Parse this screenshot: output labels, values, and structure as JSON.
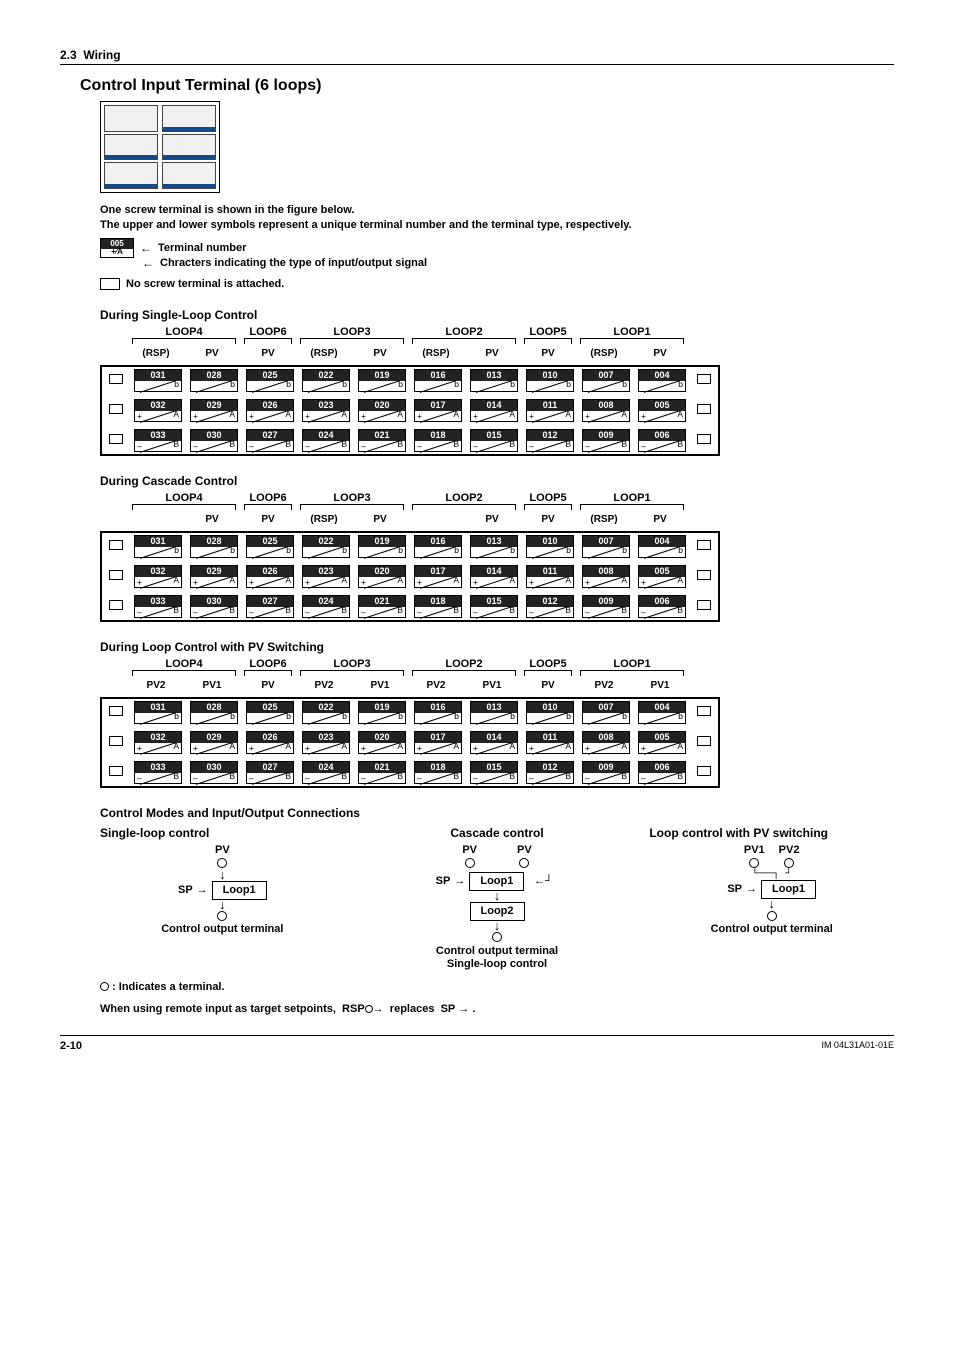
{
  "section_num": "2.3",
  "section_title": "Wiring",
  "title": "Control Input Terminal (6 loops)",
  "desc1": "One screw terminal is shown in the figure below.",
  "desc2": "The upper and lower symbols represent a unique terminal number and the terminal type, respectively.",
  "legend_terminal_num": "005",
  "legend_terminal_sym_left": "+",
  "legend_terminal_sym_right": "A",
  "legend_terminal_num_label": "Terminal number",
  "legend_terminal_sym_label": "Chracters indicating the type of input/output signal",
  "legend_no_screw": "No screw terminal is attached.",
  "single_loop_heading": "During Single-Loop Control",
  "cascade_heading": "During Cascade Control",
  "pvswitch_heading": "During Loop Control with PV Switching",
  "modes_heading": "Control Modes and Input/Output Connections",
  "mode_single": "Single-loop control",
  "mode_cascade": "Cascade control",
  "mode_pvswitch": "Loop control with PV switching",
  "loop_labels": [
    "LOOP4",
    "LOOP6",
    "LOOP3",
    "LOOP2",
    "LOOP5",
    "LOOP1"
  ],
  "col_hdrs_single": [
    "(RSP)",
    "PV",
    "PV",
    "(RSP)",
    "PV",
    "(RSP)",
    "PV",
    "PV",
    "(RSP)",
    "PV"
  ],
  "col_hdrs_cascade": [
    "",
    "PV",
    "PV",
    "(RSP)",
    "PV",
    "",
    "PV",
    "PV",
    "(RSP)",
    "PV"
  ],
  "col_hdrs_pv": [
    "PV2",
    "PV1",
    "PV",
    "PV2",
    "PV1",
    "PV2",
    "PV1",
    "PV",
    "PV2",
    "PV1"
  ],
  "row1_nums": [
    "031",
    "028",
    "025",
    "022",
    "019",
    "016",
    "013",
    "010",
    "007",
    "004"
  ],
  "row1_sym": {
    "l": "",
    "r": "b"
  },
  "row2_nums": [
    "032",
    "029",
    "026",
    "023",
    "020",
    "017",
    "014",
    "011",
    "008",
    "005"
  ],
  "row2_sym": {
    "l": "+",
    "r": "A"
  },
  "row3_nums": [
    "033",
    "030",
    "027",
    "024",
    "021",
    "018",
    "015",
    "012",
    "009",
    "006"
  ],
  "row3_sym": {
    "l": "–",
    "r": "B"
  },
  "sp_label": "SP",
  "pv_label": "PV",
  "pv1_label": "PV1",
  "pv2_label": "PV2",
  "loop1_label": "Loop1",
  "loop2_label": "Loop2",
  "cot_label": "Control output terminal",
  "cascade_sub": "Single-loop control",
  "foot_indicates": ": Indicates a terminal.",
  "foot_rsp_line_a": "When using remote input as target setpoints,",
  "foot_rsp_line_b": "replaces",
  "foot_rsp_sym": "RSP",
  "foot_sp_sym": "SP",
  "page_num": "2-10",
  "doc_code": "IM 04L31A01-01E"
}
